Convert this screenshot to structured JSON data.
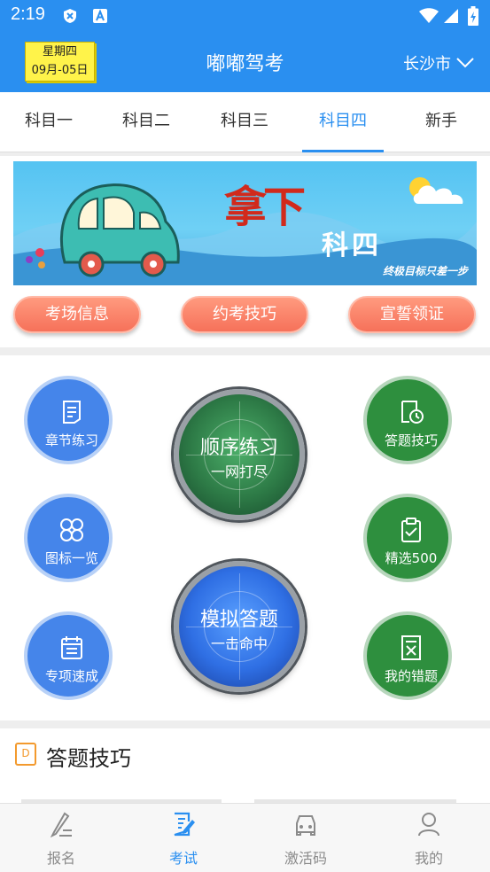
{
  "status_bar": {
    "time": "2:19"
  },
  "header": {
    "weekday": "星期四",
    "date": "09月-05日",
    "title": "嘟嘟驾考",
    "city": "长沙市"
  },
  "tabs": [
    {
      "label": "科目一"
    },
    {
      "label": "科目二"
    },
    {
      "label": "科目三"
    },
    {
      "label": "科目四"
    },
    {
      "label": "新手"
    }
  ],
  "active_tab": "科目四",
  "banner": {
    "title": "拿下",
    "subtitle": "科四",
    "slogan": "终极目标只差一步"
  },
  "quick_links": [
    {
      "label": "考场信息"
    },
    {
      "label": "约考技巧"
    },
    {
      "label": "宣誓领证"
    }
  ],
  "practice": {
    "chapter": "章节练习",
    "icons": "图标一览",
    "special": "专项速成",
    "tips": "答题技巧",
    "selected500": "精选500",
    "mistakes": "我的错题",
    "sequential": {
      "title": "顺序练习",
      "sub": "一网打尽"
    },
    "mock": {
      "title": "模拟答题",
      "sub": "一击命中"
    }
  },
  "section": {
    "title": "答题技巧"
  },
  "bottom_nav": [
    {
      "label": "报名"
    },
    {
      "label": "考试"
    },
    {
      "label": "激活码"
    },
    {
      "label": "我的"
    }
  ],
  "colors": {
    "primary": "#2a8ff0",
    "blue_button": "#4585ea",
    "green_button": "#2e8f3e",
    "pill": "#f6715a",
    "date_badge": "#fff34a"
  }
}
